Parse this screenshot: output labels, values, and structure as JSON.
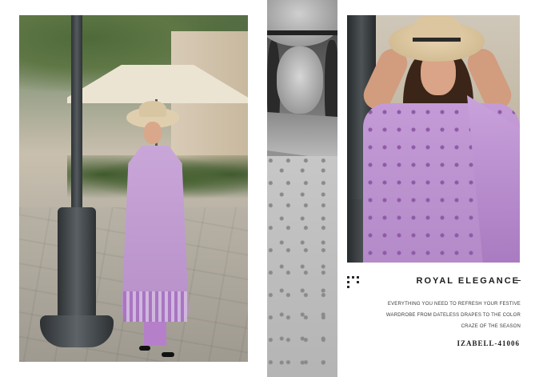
{
  "collection": {
    "title": "ROYAL ELEGANCE",
    "tagline": "EVERYTHING YOU NEED TO REFRESH YOUR FESTIVE WARDROBE FROM DATELESS DRAPES TO THE COLOR CRAZE OF THE SEASON",
    "code": "IZABELL-41006"
  },
  "colors": {
    "accent_lilac": "#b68fc8",
    "text_dark": "#1c1c1c",
    "background": "#ffffff"
  },
  "icons": {
    "decorative_dots": "dot-grid-icon"
  }
}
